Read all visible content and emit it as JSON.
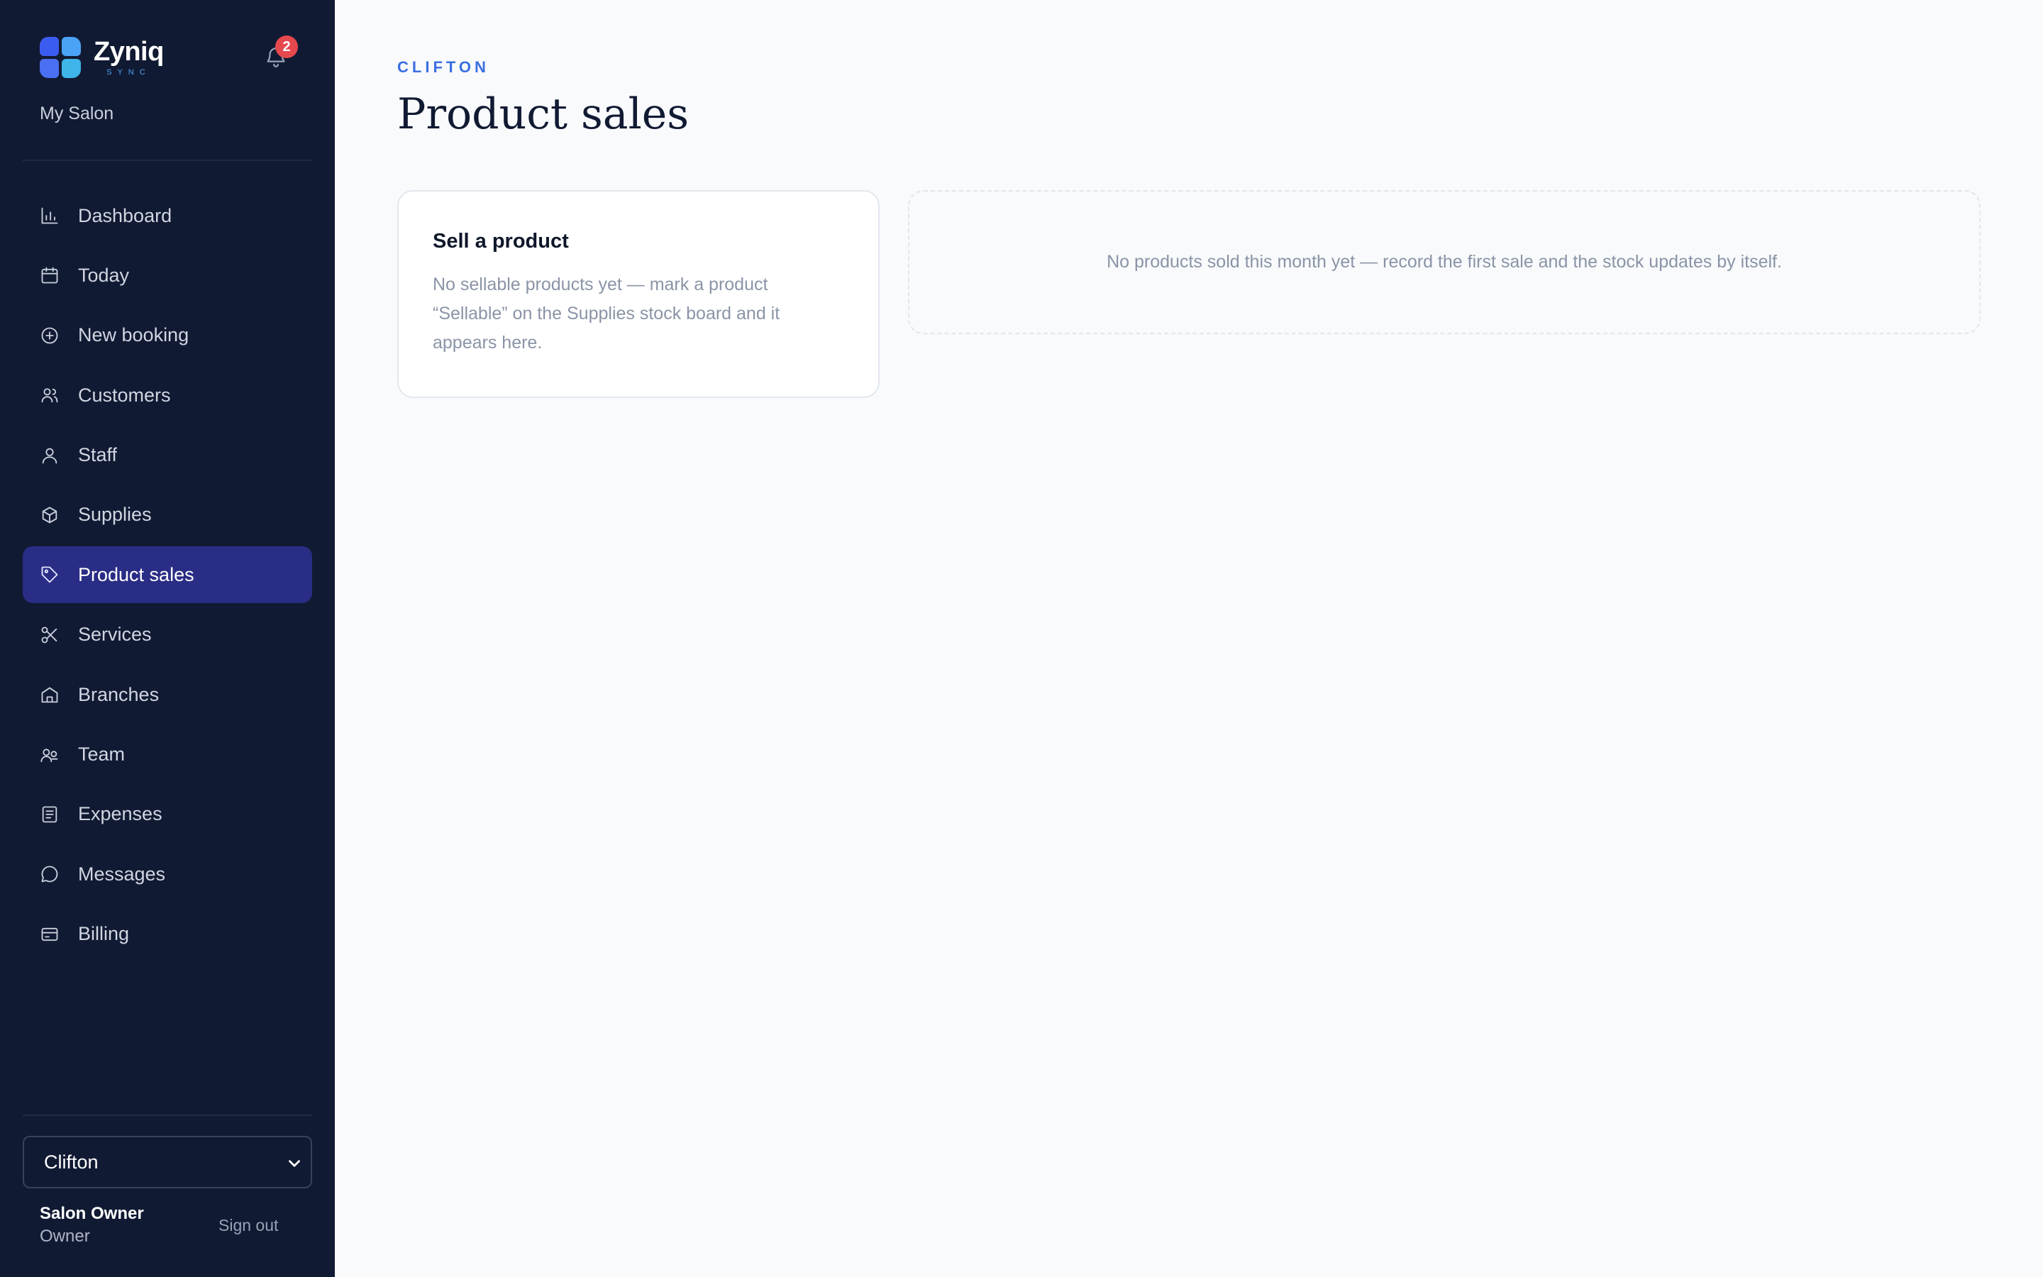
{
  "brand": {
    "name": "Zyniq",
    "sub": "SYNC"
  },
  "notifications": {
    "count": "2"
  },
  "sidebar": {
    "org": "My Salon",
    "items": [
      {
        "label": "Dashboard",
        "icon": "bar-chart-icon"
      },
      {
        "label": "Today",
        "icon": "calendar-icon"
      },
      {
        "label": "New booking",
        "icon": "plus-circle-icon"
      },
      {
        "label": "Customers",
        "icon": "users-icon"
      },
      {
        "label": "Staff",
        "icon": "user-icon"
      },
      {
        "label": "Supplies",
        "icon": "box-icon"
      },
      {
        "label": "Product sales",
        "icon": "tag-icon",
        "active": true
      },
      {
        "label": "Services",
        "icon": "scissors-icon"
      },
      {
        "label": "Branches",
        "icon": "building-icon"
      },
      {
        "label": "Team",
        "icon": "team-icon"
      },
      {
        "label": "Expenses",
        "icon": "receipt-icon"
      },
      {
        "label": "Messages",
        "icon": "message-icon"
      },
      {
        "label": "Billing",
        "icon": "credit-card-icon"
      }
    ],
    "branch_select": {
      "value": "Clifton"
    },
    "user": {
      "name": "Salon Owner",
      "role": "Owner",
      "signout": "Sign out"
    }
  },
  "main": {
    "eyebrow": "CLIFTON",
    "title": "Product sales",
    "sell_card": {
      "title": "Sell a product",
      "body": "No sellable products yet — mark a product “Sellable” on the Supplies stock board and it appears here."
    },
    "empty_state": "No products sold this month yet — record the first sale and the stock updates by itself."
  },
  "colors": {
    "sidebar_bg": "#111a33",
    "active_item_bg": "#2a2d85",
    "accent": "#3b6fe0",
    "badge": "#e5484d",
    "page_bg": "#f8fafc"
  }
}
